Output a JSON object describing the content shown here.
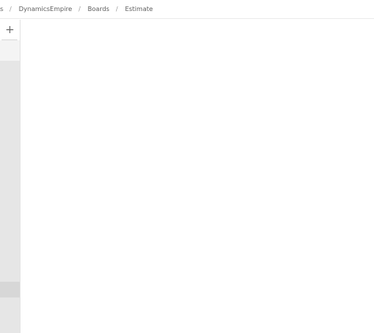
{
  "breadcrumb": {
    "items": [
      {
        "label": "s"
      },
      {
        "label": "DynamicsEmpire"
      },
      {
        "label": "Boards"
      },
      {
        "label": "Estimate"
      }
    ],
    "separator": "/"
  },
  "sidebar": {
    "add_label": "+"
  },
  "colors": {
    "rail": "#e6e6e6",
    "thumb": "#d7d7d7",
    "text": "#5f5f5f"
  }
}
